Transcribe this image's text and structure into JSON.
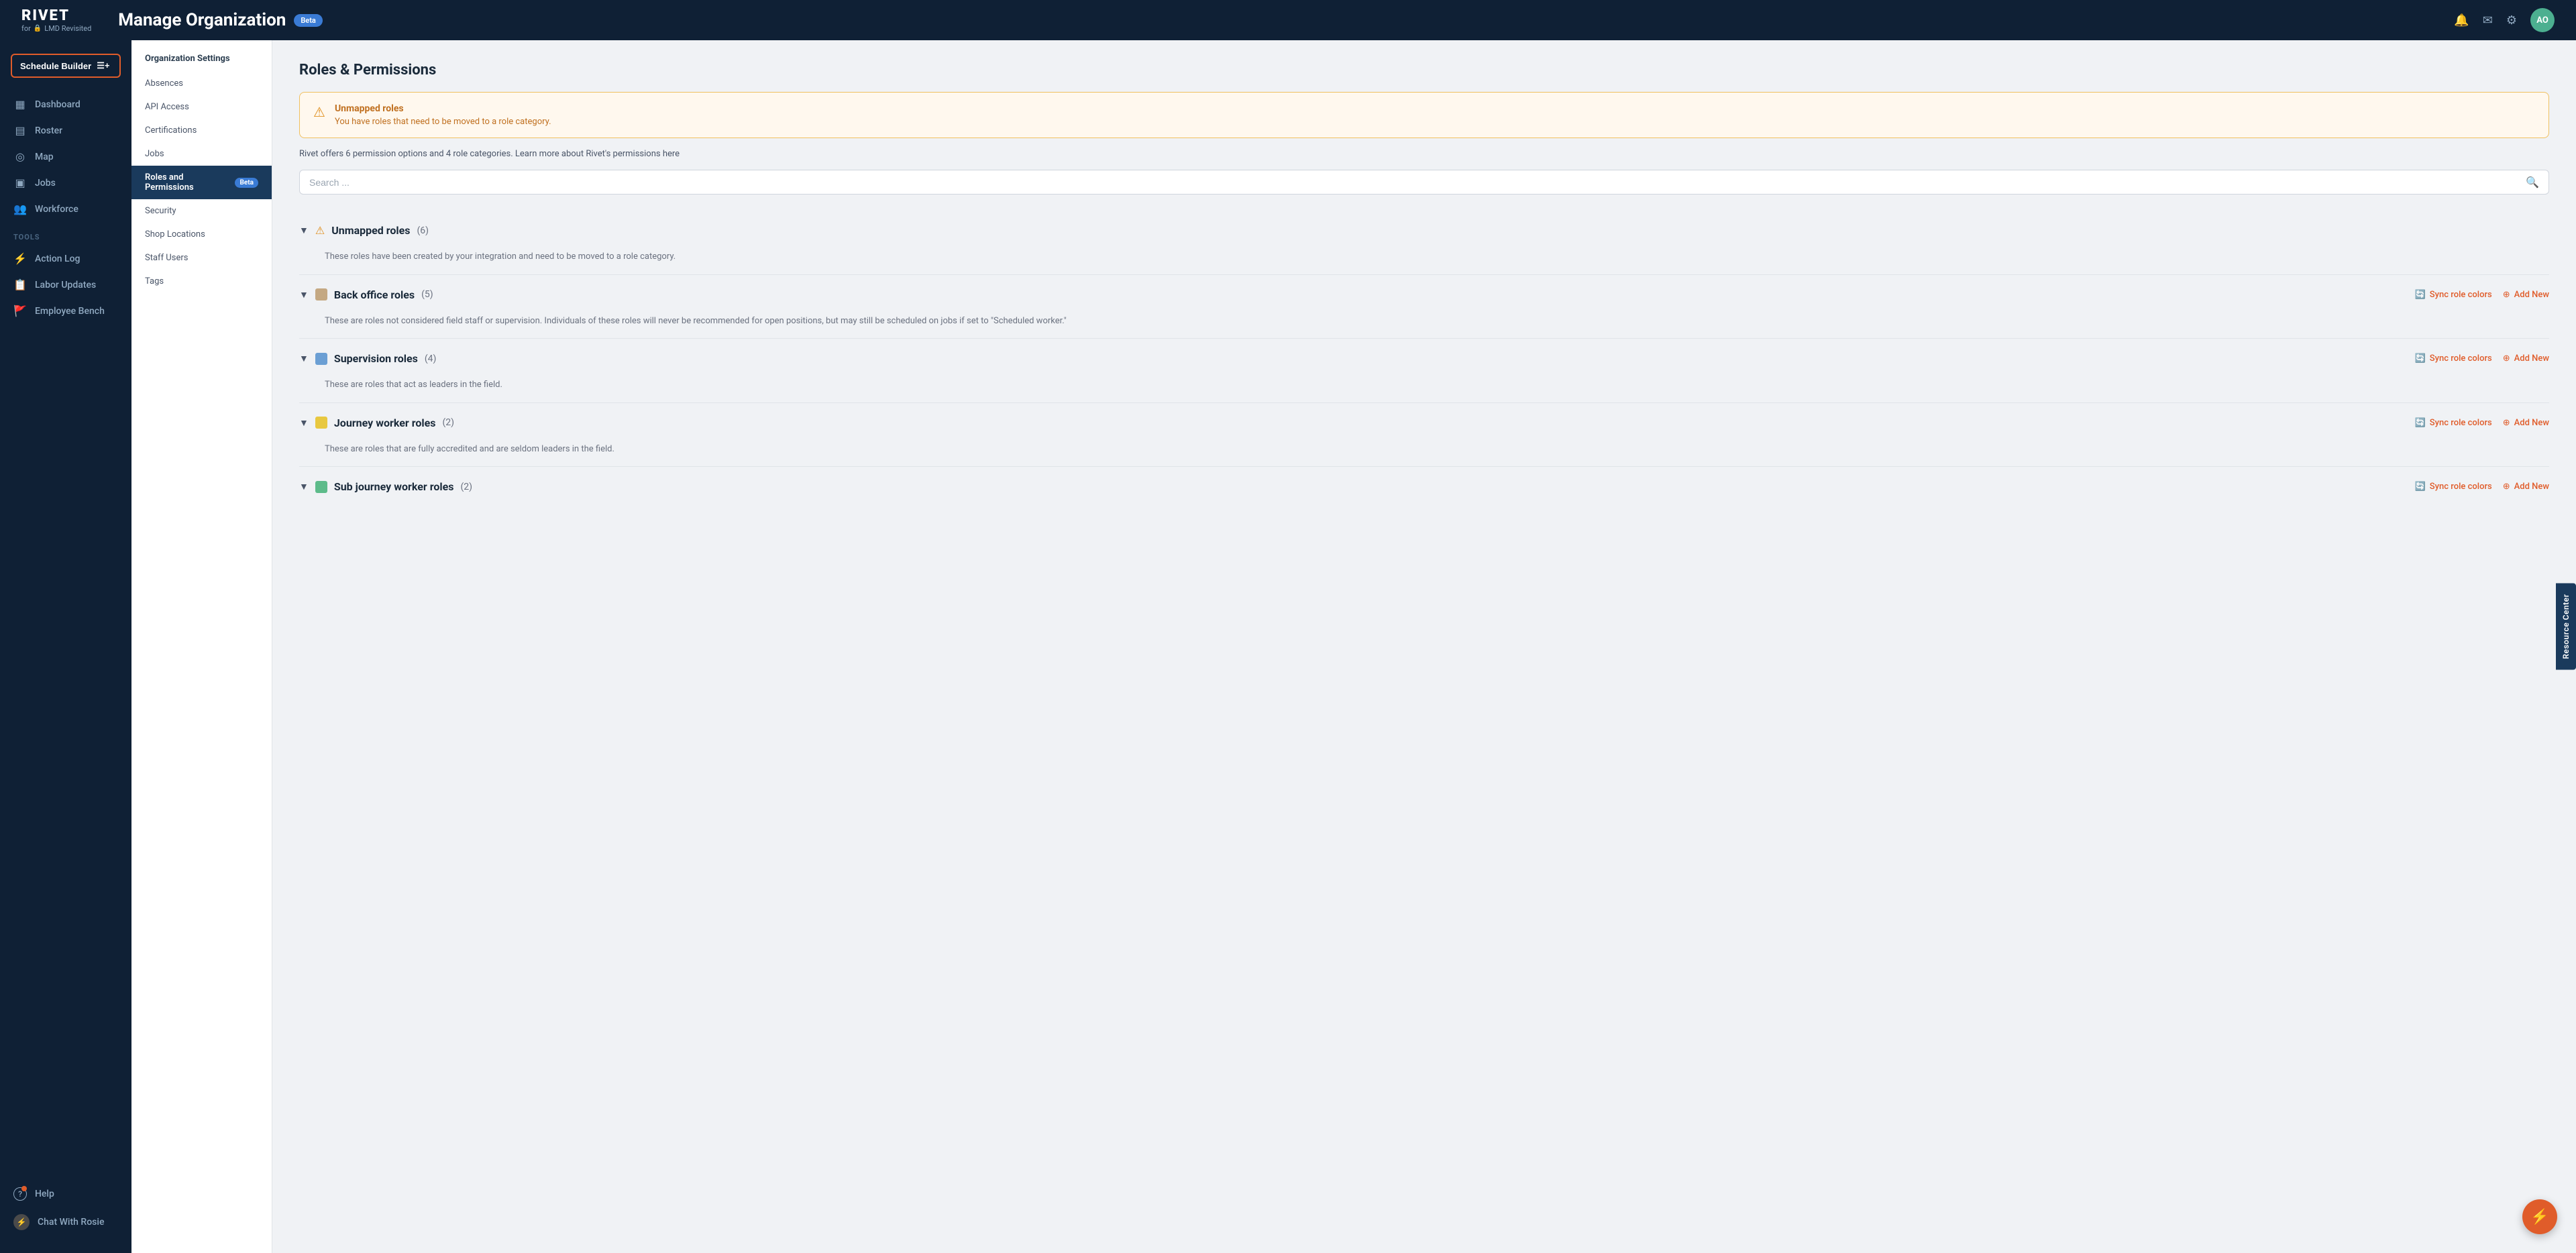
{
  "header": {
    "logo": "RIVET",
    "logo_sub": "for",
    "org_name": "LMD Revisited",
    "page_title": "Manage Organization",
    "beta_label": "Beta",
    "actions": {
      "bell_icon": "🔔",
      "mail_icon": "✉",
      "gear_icon": "⚙",
      "avatar_text": "AO"
    }
  },
  "sidebar": {
    "schedule_button": "Schedule Builder",
    "nav_items": [
      {
        "label": "Dashboard",
        "icon": "▦"
      },
      {
        "label": "Roster",
        "icon": "▤"
      },
      {
        "label": "Map",
        "icon": "◎"
      },
      {
        "label": "Jobs",
        "icon": "▣"
      },
      {
        "label": "Workforce",
        "icon": "👥"
      }
    ],
    "tools_label": "TOOLS",
    "tools_items": [
      {
        "label": "Action Log",
        "icon": "⚡"
      },
      {
        "label": "Labor Updates",
        "icon": "📋"
      },
      {
        "label": "Employee Bench",
        "icon": "🚩"
      }
    ],
    "help_label": "Help",
    "help_icon": "?",
    "rosie_label": "Chat With Rosie",
    "rosie_icon": "⚡"
  },
  "secondary_nav": {
    "title": "Organization Settings",
    "items": [
      {
        "label": "Absences",
        "active": false
      },
      {
        "label": "API Access",
        "active": false
      },
      {
        "label": "Certifications",
        "active": false
      },
      {
        "label": "Jobs",
        "active": false
      },
      {
        "label": "Roles and Permissions",
        "active": true,
        "badge": "Beta"
      },
      {
        "label": "Security",
        "active": false
      },
      {
        "label": "Shop Locations",
        "active": false
      },
      {
        "label": "Staff Users",
        "active": false
      },
      {
        "label": "Tags",
        "active": false
      }
    ]
  },
  "main": {
    "section_title": "Roles & Permissions",
    "warning": {
      "title": "Unmapped roles",
      "description": "You have roles that need to be moved to a role category."
    },
    "info_text": "Rivet offers 6 permission options and 4 role categories. Learn more about Rivet's permissions here",
    "search_placeholder": "Search ...",
    "role_sections": [
      {
        "name": "Unmapped roles",
        "count": 6,
        "count_display": "(6)",
        "color": "",
        "has_warning": true,
        "description": "These roles have been created by your integration and need to be moved to a role category.",
        "show_actions": false
      },
      {
        "name": "Back office roles",
        "count": 5,
        "count_display": "(5)",
        "color": "#c4a882",
        "has_warning": false,
        "description": "These are roles not considered field staff or supervision. Individuals of these roles will never be recommended for open positions, but may still be scheduled on jobs if set to \"Scheduled worker.\"",
        "show_actions": true,
        "sync_label": "Sync role colors",
        "add_label": "Add New"
      },
      {
        "name": "Supervision roles",
        "count": 4,
        "count_display": "(4)",
        "color": "#6b9fd4",
        "has_warning": false,
        "description": "These are roles that act as leaders in the field.",
        "show_actions": true,
        "sync_label": "Sync role colors",
        "add_label": "Add New"
      },
      {
        "name": "Journey worker roles",
        "count": 2,
        "count_display": "(2)",
        "color": "#e8c840",
        "has_warning": false,
        "description": "These are roles that are fully accredited and are seldom leaders in the field.",
        "show_actions": true,
        "sync_label": "Sync role colors",
        "add_label": "Add New"
      },
      {
        "name": "Sub journey worker roles",
        "count": 2,
        "count_display": "(2)",
        "color": "#5dbb8a",
        "has_warning": false,
        "description": "",
        "show_actions": true,
        "sync_label": "Sync role colors",
        "add_label": "Add New"
      }
    ]
  },
  "resource_center_label": "Resource Center"
}
